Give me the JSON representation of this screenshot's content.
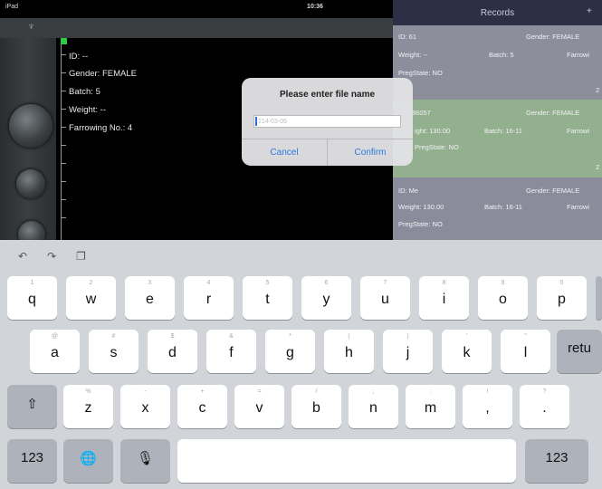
{
  "status": {
    "left": "iPad",
    "time": "10:36"
  },
  "records_panel": {
    "title": "Records",
    "plus": "+",
    "records": [
      {
        "id": "ID: 61",
        "gender": "Gender: FEMALE",
        "weight": "Weight: --",
        "batch": "Batch: 5",
        "farrow": "Farrowi",
        "preg": "PregState: NO",
        "num": "2"
      },
      {
        "id": "86057",
        "gender": "Gender: FEMALE",
        "weight": "ight: 130.00",
        "batch": "Batch: 16-11",
        "farrow": "Farrowi",
        "preg": "PregState: NO",
        "num": "2"
      },
      {
        "id": "ID: Me",
        "gender": "Gender: FEMALE",
        "weight": "Weight: 130.00",
        "batch": "Batch: 16-11",
        "farrow": "Farrowi",
        "preg": "PregState: NO"
      }
    ]
  },
  "info": {
    "id": "ID: --",
    "gender": "Gender: FEMALE",
    "batch": "Batch: 5",
    "weight": "Weight: --",
    "farrowing": "Farrowing No.: 4"
  },
  "dialog": {
    "title": "Please enter file name",
    "placeholder": "214-03-05",
    "cancel": "Cancel",
    "confirm": "Confirm"
  },
  "keyboard": {
    "toolbar": [
      "↶",
      "↷",
      "❐"
    ],
    "row1": [
      {
        "hint": "1",
        "key": "q"
      },
      {
        "hint": "2",
        "key": "w"
      },
      {
        "hint": "3",
        "key": "e"
      },
      {
        "hint": "4",
        "key": "r"
      },
      {
        "hint": "5",
        "key": "t"
      },
      {
        "hint": "6",
        "key": "y"
      },
      {
        "hint": "7",
        "key": "u"
      },
      {
        "hint": "8",
        "key": "i"
      },
      {
        "hint": "9",
        "key": "o"
      },
      {
        "hint": "0",
        "key": "p"
      }
    ],
    "row2": [
      {
        "hint": "@",
        "key": "a"
      },
      {
        "hint": "#",
        "key": "s"
      },
      {
        "hint": "$",
        "key": "d"
      },
      {
        "hint": "&",
        "key": "f"
      },
      {
        "hint": "*",
        "key": "g"
      },
      {
        "hint": "(",
        "key": "h"
      },
      {
        "hint": ")",
        "key": "j"
      },
      {
        "hint": "'",
        "key": "k"
      },
      {
        "hint": "\"",
        "key": "l"
      }
    ],
    "row3": [
      {
        "hint": "%",
        "key": "z"
      },
      {
        "hint": "-",
        "key": "x"
      },
      {
        "hint": "+",
        "key": "c"
      },
      {
        "hint": "=",
        "key": "v"
      },
      {
        "hint": "/",
        "key": "b"
      },
      {
        "hint": ";",
        "key": "n"
      },
      {
        "hint": ":",
        "key": "m"
      },
      {
        "hint": "!",
        "key": ","
      },
      {
        "hint": "?",
        "key": "."
      }
    ],
    "return_label": "retu",
    "shift_label": "⇧",
    "numbers_label": "123",
    "globe_label": "🌐",
    "mic_label": "🎙",
    "numbers_right_label": "123"
  }
}
